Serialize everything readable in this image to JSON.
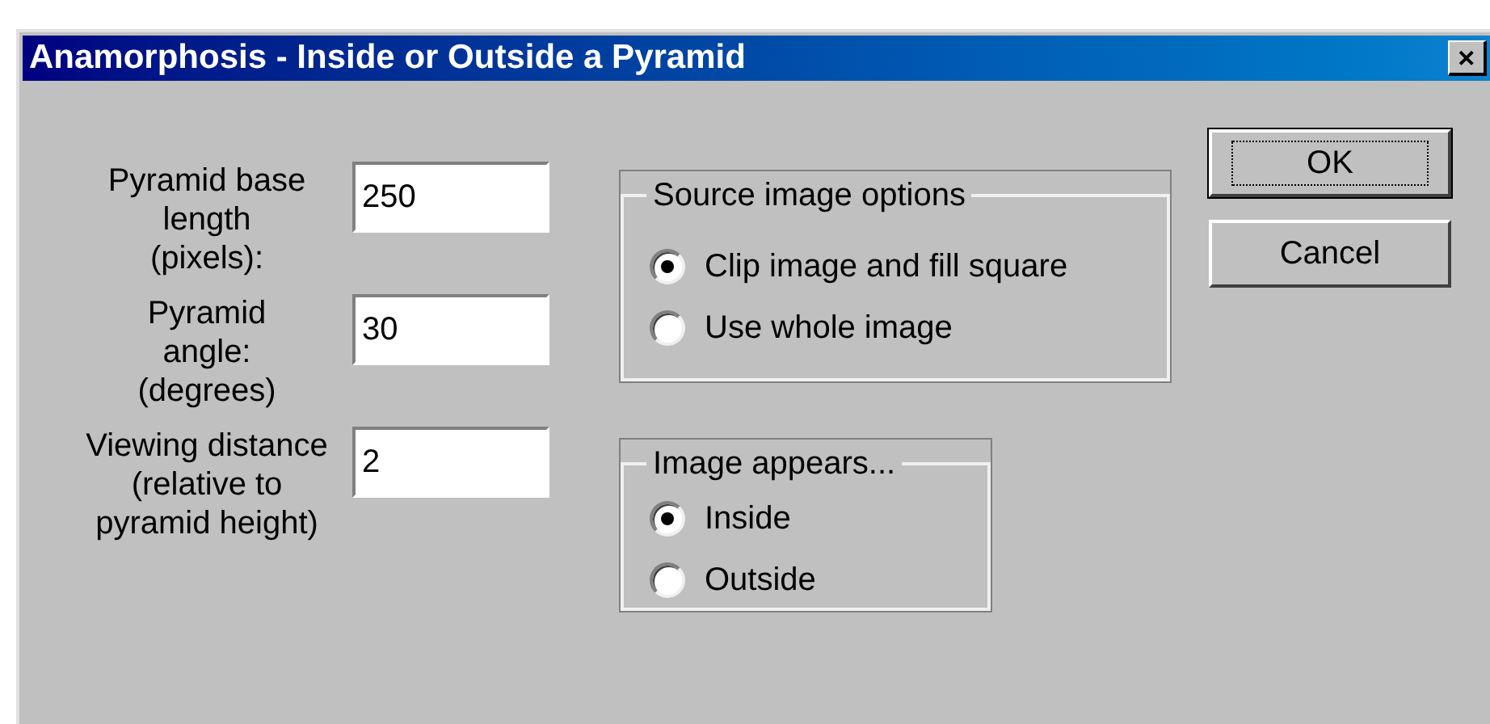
{
  "window": {
    "title": "Anamorphosis - Inside or Outside a Pyramid",
    "close": "✕"
  },
  "fields": [
    {
      "label": "Pyramid base\nlength\n(pixels):",
      "value": "250"
    },
    {
      "label": "Pyramid\nangle:\n(degrees)",
      "value": "30"
    },
    {
      "label": "Viewing distance\n(relative to\npyramid height)",
      "value": "2"
    }
  ],
  "groups": [
    {
      "title": "Source image options",
      "options": [
        {
          "label": "Clip image and fill square",
          "selected": true
        },
        {
          "label": "Use whole image",
          "selected": false
        }
      ]
    },
    {
      "title": "Image appears...",
      "options": [
        {
          "label": "Inside",
          "selected": true
        },
        {
          "label": "Outside",
          "selected": false
        }
      ]
    }
  ],
  "buttons": [
    {
      "label": "OK",
      "default": true
    },
    {
      "label": "Cancel",
      "default": false
    }
  ]
}
